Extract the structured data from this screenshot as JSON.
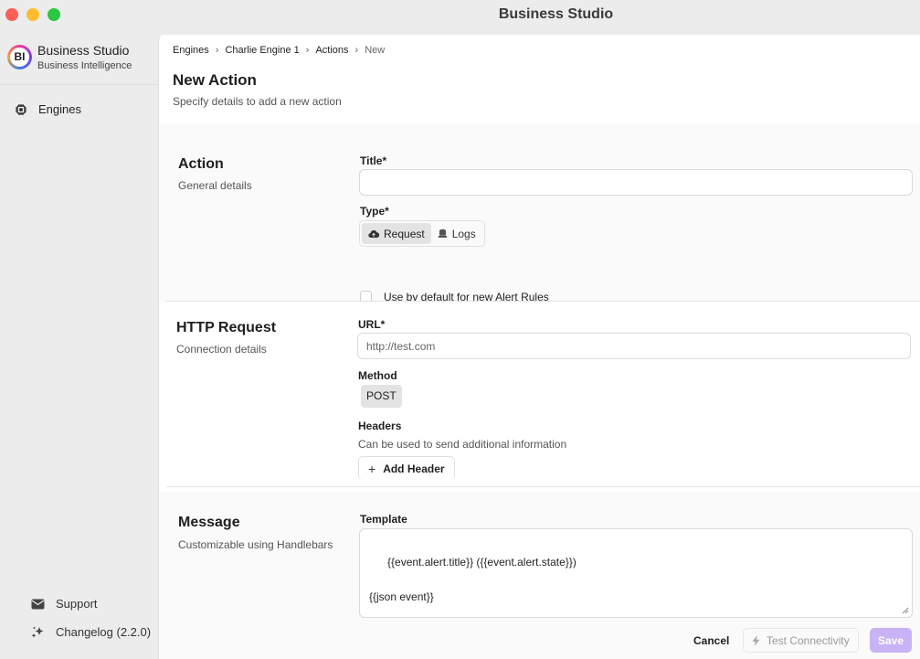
{
  "window": {
    "title": "Business Studio"
  },
  "brand": {
    "logo_text": "BI",
    "name": "Business Studio",
    "subtitle": "Business Intelligence"
  },
  "sidebar": {
    "items": [
      {
        "label": "Engines",
        "icon": "chip-icon"
      }
    ],
    "footer": [
      {
        "label": "Support",
        "icon": "envelope-icon"
      },
      {
        "label": "Changelog (2.2.0)",
        "icon": "sparkles-icon"
      }
    ]
  },
  "breadcrumb": [
    "Engines",
    "Charlie Engine 1",
    "Actions",
    "New"
  ],
  "page": {
    "title": "New Action",
    "subtitle": "Specify details to add a new action"
  },
  "action_section": {
    "title": "Action",
    "subtitle": "General details",
    "title_label": "Title*",
    "title_value": "",
    "type_label": "Type*",
    "type_options": [
      {
        "label": "Request",
        "icon": "cloud-upload-icon",
        "selected": true
      },
      {
        "label": "Logs",
        "icon": "database-icon",
        "selected": false
      }
    ],
    "default_checkbox_label": "Use by default for new Alert Rules",
    "default_checked": false
  },
  "http_section": {
    "title": "HTTP Request",
    "subtitle": "Connection details",
    "url_label": "URL*",
    "url_placeholder": "http://test.com",
    "method_label": "Method",
    "method_value": "POST",
    "headers_label": "Headers",
    "headers_hint": "Can be used to send additional information",
    "add_header_label": "Add Header"
  },
  "message_section": {
    "title": "Message",
    "subtitle": "Customizable using Handlebars",
    "template_label": "Template",
    "template_value": "{{event.alert.title}} ({{event.alert.state}})\n\n{{json event}}"
  },
  "actions": {
    "cancel": "Cancel",
    "test": "Test Connectivity",
    "save": "Save"
  },
  "colors": {
    "accent_disabled": "#c7b3f5",
    "sidebar_bg": "#ececec"
  }
}
